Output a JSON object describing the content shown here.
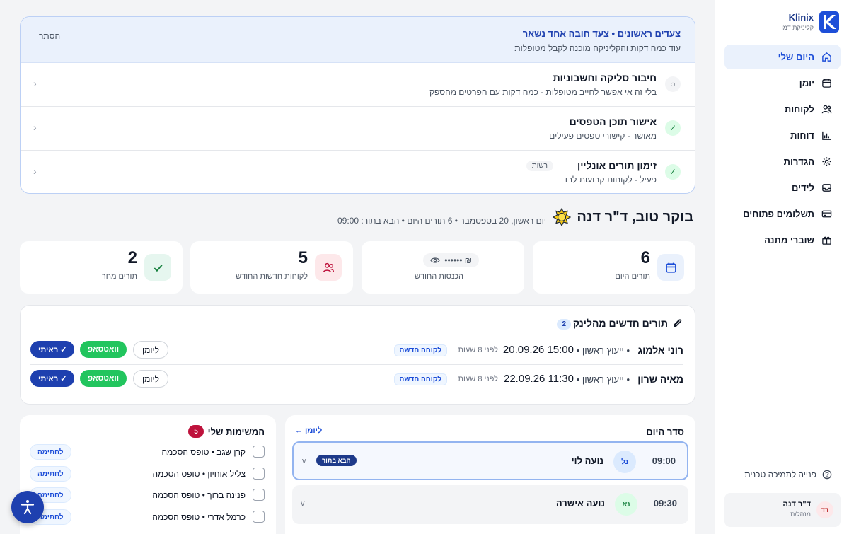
{
  "brand": {
    "name": "Klinix",
    "subtitle": "קליניקת דמו"
  },
  "nav": [
    {
      "label": "היום שלי",
      "icon": "home-icon",
      "active": true
    },
    {
      "label": "יומן",
      "icon": "calendar-icon"
    },
    {
      "label": "לקוחות",
      "icon": "users-icon"
    },
    {
      "label": "דוחות",
      "icon": "bar-chart-icon"
    },
    {
      "label": "הגדרות",
      "icon": "gear-icon"
    },
    {
      "label": "לידים",
      "icon": "inbox-icon"
    },
    {
      "label": "תשלומים פתוחים",
      "icon": "credit-card-icon"
    },
    {
      "label": "שוברי מתנה",
      "icon": "gift-icon"
    }
  ],
  "support": {
    "label": "פנייה לתמיכה טכנית"
  },
  "user": {
    "initials": "דד",
    "name": "ד\"ר דנה",
    "role": "מנהל/ת"
  },
  "onboarding": {
    "title": "צעדים ראשונים • צעד חובה אחד נשאר",
    "subtitle": "עוד כמה דקות והקליניקה מוכנה לקבל מטופלות",
    "hide_label": "הסתר",
    "steps": [
      {
        "status": "pending",
        "mark": "○",
        "title": "חיבור סליקה וחשבוניות",
        "desc": "בלי זה אי אפשר לחייב מטופלות - כמה דקות עם הפרטים מהספק",
        "tag": ""
      },
      {
        "status": "done",
        "mark": "✓",
        "title": "אישור תוכן הטפסים",
        "desc": "מאושר - קישורי טפסים פעילים",
        "tag": ""
      },
      {
        "status": "done",
        "mark": "✓",
        "title": "זימון תורים אונליין",
        "desc": "פעיל - לקוחות קבועות לבד",
        "tag": "רשות"
      }
    ]
  },
  "greeting": {
    "title": "בוקר טוב, ד\"ר דנה",
    "meta": "יום ראשון, 20 בספטמבר • 6 תורים היום • הבא בתור: 09:00"
  },
  "stats": [
    {
      "value": "6",
      "label": "תורים היום",
      "icon": "calendar-icon",
      "color": "#eaf1fc",
      "icon_color": "#1d4ed8"
    },
    {
      "value": "₪ ••••••",
      "label": "הכנסות החודש",
      "icon": "eye-icon",
      "masked": true
    },
    {
      "value": "5",
      "label": "לקוחות חדשות החודש",
      "icon": "users-icon",
      "color": "#fde8ea",
      "icon_color": "#be123c"
    },
    {
      "value": "2",
      "label": "תורים מחר",
      "icon": "check-icon",
      "color": "#e6f6ef",
      "icon_color": "#15803d"
    }
  ],
  "link_bookings": {
    "title": "תורים חדשים מהלינק",
    "count": "2",
    "actions": {
      "calendar": "ליומן",
      "whatsapp": "וואטסאפ",
      "seen": "✓ ראיתי"
    },
    "items": [
      {
        "name": "רוני אלמוג",
        "service": "• ייעוץ ראשון •",
        "datetime": "15:00 20.09.26",
        "ago": "לפני 8 שעות",
        "badge": "לקוחה חדשה"
      },
      {
        "name": "מאיה שרון",
        "service": "• ייעוץ ראשון •",
        "datetime": "11:30 22.09.26",
        "ago": "לפני 8 שעות",
        "badge": "לקוחה חדשה"
      }
    ]
  },
  "schedule": {
    "title": "סדר היום",
    "link": "ליומן ←",
    "items": [
      {
        "time": "09:00",
        "initials": "נל",
        "name": "נועה לוי",
        "badge": "הבא בתור",
        "chev": "v",
        "color": "#dbeafe",
        "text_color": "#1d4ed8"
      },
      {
        "time": "09:30",
        "initials": "נא",
        "name": "נועה אישרה",
        "badge": "",
        "chev": "v",
        "color": "#dcfce7",
        "text_color": "#15803d"
      }
    ]
  },
  "tasks": {
    "title": "המשימות שלי",
    "count": "5",
    "action_label": "לחתימה",
    "items": [
      {
        "text": "קרן שגב • טופס הסכמה"
      },
      {
        "text": "צליל אוחיון • טופס הסכמה"
      },
      {
        "text": "פנינה ברוך • טופס הסכמה"
      },
      {
        "text": "כרמל אדרי • טופס הסכמה"
      }
    ]
  }
}
